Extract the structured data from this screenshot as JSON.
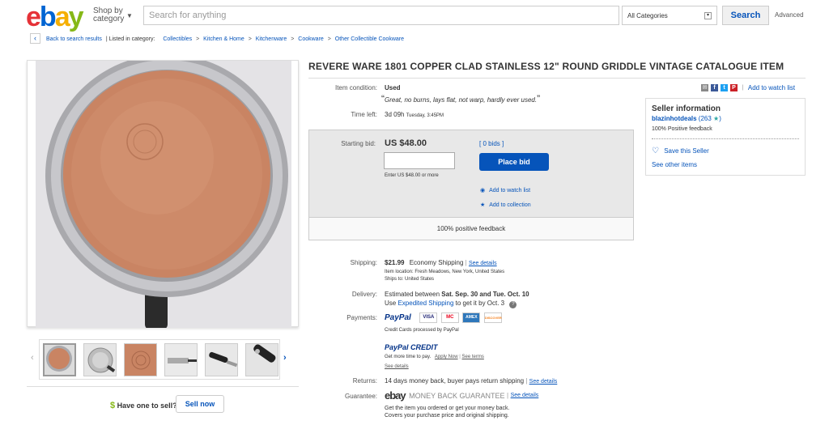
{
  "header": {
    "logo": {
      "e": "e",
      "b": "b",
      "a": "a",
      "y": "y"
    },
    "shop_by": "Shop by",
    "category": "category",
    "search_placeholder": "Search for anything",
    "category_select": "All Categories",
    "search_button": "Search",
    "advanced": "Advanced"
  },
  "breadcrumb": {
    "back": "Back to search results",
    "listed_in": "| Listed in category:",
    "items": [
      "Collectibles",
      "Kitchen & Home",
      "Kitchenware",
      "Cookware",
      "Other Collectible Cookware"
    ],
    "separator": ">"
  },
  "item": {
    "title": "REVERE WARE 1801 COPPER CLAD STAINLESS 12\" ROUND GRIDDLE VINTAGE CATALOGUE ITEM",
    "condition_label": "Item condition:",
    "condition_value": "Used",
    "condition_note": "Great, no burns, lays flat, not warp, hardly ever used.",
    "quote_open": "“",
    "quote_close": "”",
    "time_left_label": "Time left:",
    "time_left_value": "3d 09h",
    "time_left_end": "Tuesday, 3:45PM"
  },
  "bid": {
    "starting_bid_label": "Starting bid:",
    "starting_bid_value": "US $48.00",
    "bids_link": "[ 0 bids ]",
    "input_value": "",
    "enter_hint": "Enter US $48.00 or more",
    "place_bid_button": "Place bid",
    "watch_link": "Add to watch list",
    "collection_link": "Add to collection",
    "feedback": "100% positive feedback"
  },
  "share": {
    "watch_link": "Add to watch list",
    "separator": "|",
    "icons": [
      "email-icon",
      "facebook-icon",
      "twitter-icon",
      "pinterest-icon"
    ],
    "glyphs": [
      "✉",
      "f",
      "t",
      "P"
    ]
  },
  "seller": {
    "heading": "Seller information",
    "name": "blazinhotdeals",
    "score": "(263",
    "score_close": ")",
    "feedback": "100% Positive feedback",
    "save_seller": "Save this Seller",
    "see_other": "See other items"
  },
  "shipping": {
    "label": "Shipping:",
    "cost": "$21.99",
    "method": "Economy Shipping",
    "details": "See details",
    "location": "Item location:  Fresh Meadows, New York, United States",
    "ships_to": "Ships to:  United States"
  },
  "delivery": {
    "label": "Delivery:",
    "estimate_prefix": "Estimated between",
    "estimate_dates": "Sat. Sep. 30 and Tue. Oct. 10",
    "use": "Use",
    "expedited": "Expedited Shipping",
    "suffix": "to get it by Oct. 3",
    "info_glyph": "?"
  },
  "payments": {
    "label": "Payments:",
    "paypal": "PayPal",
    "cards": [
      "VISA",
      "MC",
      "AMEX",
      "DISCOVER"
    ],
    "cards_note": "Credit Cards processed by PayPal",
    "paypal_credit": "PayPal CREDIT",
    "more_time": "Get more time to pay.",
    "apply_now": "Apply Now",
    "see_terms": "See terms",
    "see_details": "See details"
  },
  "returns": {
    "label": "Returns:",
    "value": "14 days money back, buyer pays return shipping",
    "details": "See details"
  },
  "guarantee": {
    "label": "Guarantee:",
    "brand": "ebay",
    "title": "MONEY BACK GUARANTEE",
    "details": "See details",
    "line1": "Get the item you ordered or get your money back.",
    "line2": "Covers your purchase price and original shipping."
  },
  "sell": {
    "dollar": "$",
    "prompt": "Have one to sell?",
    "button": "Sell now"
  },
  "gallery": {
    "prev": "‹",
    "next": "›",
    "thumbnails": [
      "copper bottom",
      "top view",
      "stamp closeup",
      "side view",
      "handle",
      "handle closeup"
    ]
  },
  "colors": {
    "link": "#0654ba",
    "ebay_red": "#e53238",
    "ebay_blue": "#0064d2",
    "ebay_yellow": "#f5af02",
    "ebay_green": "#86b817",
    "copper": "#c98463"
  }
}
